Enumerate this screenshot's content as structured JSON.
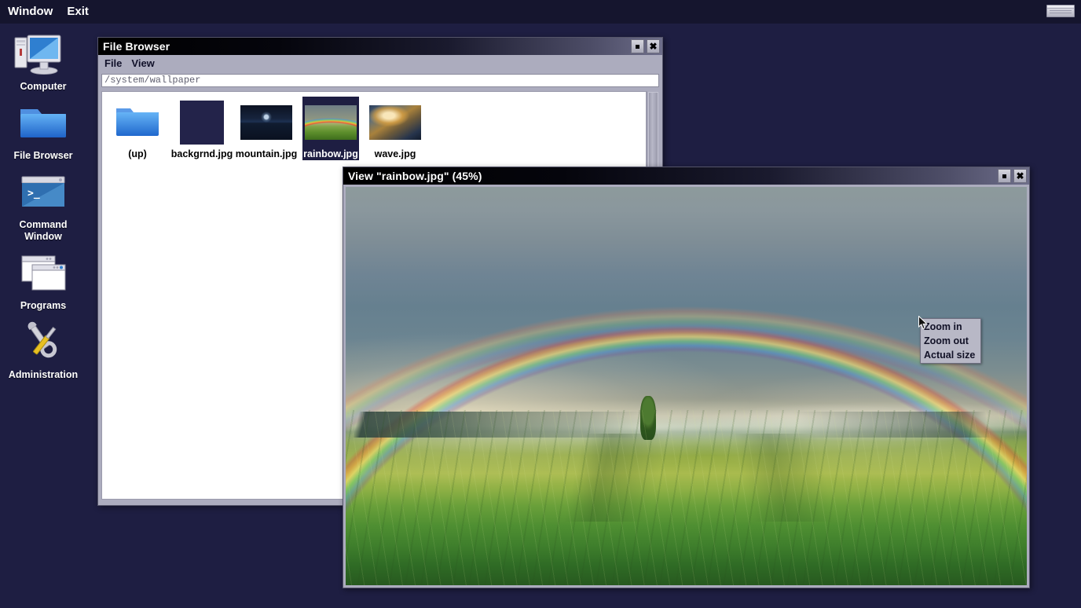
{
  "menubar": {
    "items": [
      {
        "label": "Window",
        "name": "menu-window"
      },
      {
        "label": "Exit",
        "name": "menu-exit"
      }
    ],
    "tray_icon": "minimized-window-icon"
  },
  "desktop": {
    "background_color": "#1e1e42",
    "icons": [
      {
        "label": "Computer",
        "icon": "computer-icon"
      },
      {
        "label": "File Browser",
        "icon": "folder-icon"
      },
      {
        "label": "Command Window",
        "icon": "terminal-icon"
      },
      {
        "label": "Programs",
        "icon": "windows-stack-icon"
      },
      {
        "label": "Administration",
        "icon": "tools-icon"
      }
    ]
  },
  "file_browser": {
    "title": "File Browser",
    "menu": [
      {
        "label": "File"
      },
      {
        "label": "View"
      }
    ],
    "path_value": "/system/wallpaper",
    "path_placeholder": "/system/wallpaper",
    "buttons": {
      "restore": "▪",
      "close": "✖"
    },
    "files": [
      {
        "name": "(up)",
        "thumb": "folder-icon",
        "selected": false
      },
      {
        "name": "backgrnd.jpg",
        "thumb": "tn-backgrnd",
        "selected": false
      },
      {
        "name": "mountain.jpg",
        "thumb": "tn-mountain",
        "selected": false
      },
      {
        "name": "rainbow.jpg",
        "thumb": "tn-rainbow",
        "selected": true
      },
      {
        "name": "wave.jpg",
        "thumb": "tn-wave",
        "selected": false
      }
    ]
  },
  "view_window": {
    "title": "View \"rainbow.jpg\" (45%)",
    "file_name": "rainbow.jpg",
    "zoom_level": "45%",
    "image_description": "rainbow over green field",
    "buttons": {
      "restore": "▪",
      "close": "✖"
    }
  },
  "context_menu": {
    "items": [
      {
        "label": "Zoom in"
      },
      {
        "label": "Zoom out"
      },
      {
        "label": "Actual size"
      }
    ]
  }
}
